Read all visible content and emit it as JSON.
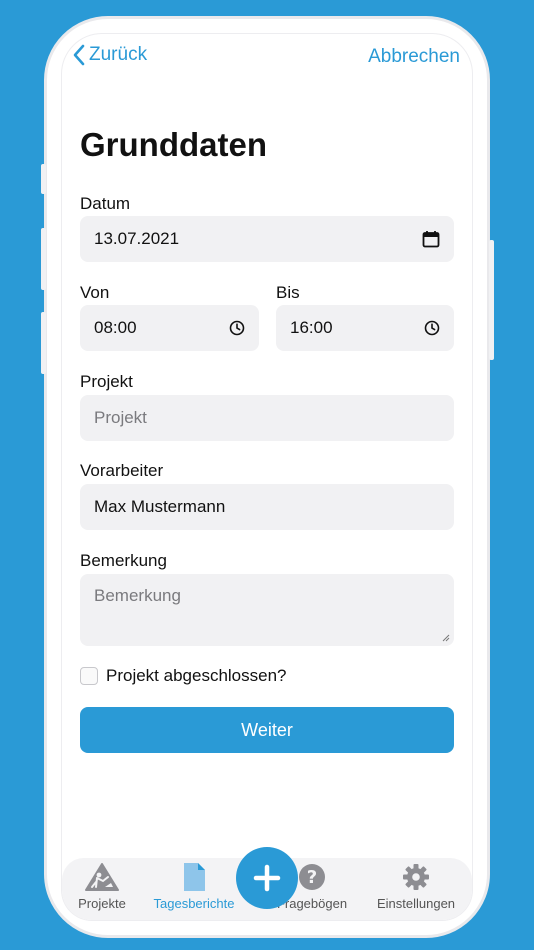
{
  "nav": {
    "back_label": "Zurück",
    "cancel_label": "Abbrechen"
  },
  "page_title": "Grunddaten",
  "form": {
    "datum_label": "Datum",
    "datum_value": "13.07.2021",
    "von_label": "Von",
    "von_value": "08:00",
    "bis_label": "Bis",
    "bis_value": "16:00",
    "projekt_label": "Projekt",
    "projekt_placeholder": "Projekt",
    "vorarbeiter_label": "Vorarbeiter",
    "vorarbeiter_value": "Max Mustermann",
    "bemerkung_label": "Bemerkung",
    "bemerkung_placeholder": "Bemerkung",
    "checkbox_label": "Projekt abgeschlossen?",
    "submit_label": "Weiter"
  },
  "tabs": [
    {
      "label": "Projekte",
      "icon": "construction-icon"
    },
    {
      "label": "Tagesberichte",
      "icon": "document-icon",
      "active": true
    },
    {
      "label": "Fragebögen",
      "icon": "question-icon"
    },
    {
      "label": "Einstellungen",
      "icon": "gear-icon"
    }
  ],
  "colors": {
    "accent": "#2a9ad6",
    "field_bg": "#f1f1f3"
  }
}
